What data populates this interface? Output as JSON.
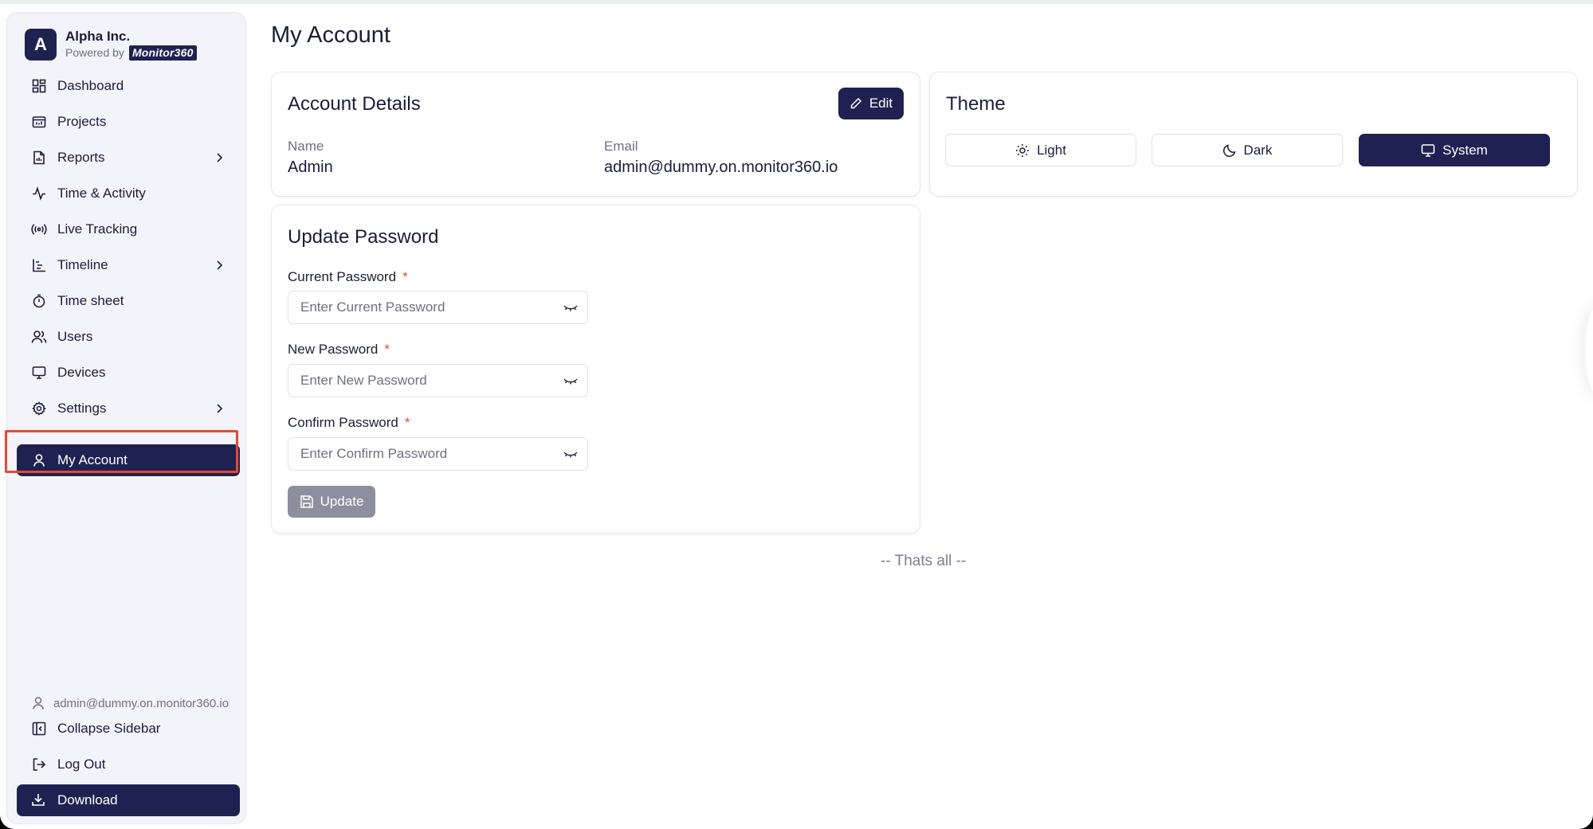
{
  "brand": {
    "initial": "A",
    "name": "Alpha Inc.",
    "powered_by": "Powered by",
    "logo_text": "Monitor360"
  },
  "sidebar": {
    "items": [
      {
        "label": "Dashboard",
        "icon": "dashboard-icon"
      },
      {
        "label": "Projects",
        "icon": "projects-icon"
      },
      {
        "label": "Reports",
        "icon": "reports-icon",
        "has_submenu": true
      },
      {
        "label": "Time & Activity",
        "icon": "activity-icon"
      },
      {
        "label": "Live Tracking",
        "icon": "live-tracking-icon"
      },
      {
        "label": "Timeline",
        "icon": "timeline-icon",
        "has_submenu": true
      },
      {
        "label": "Time sheet",
        "icon": "timer-icon"
      },
      {
        "label": "Users",
        "icon": "users-icon"
      },
      {
        "label": "Devices",
        "icon": "monitor-icon"
      },
      {
        "label": "Settings",
        "icon": "gear-icon",
        "has_submenu": true
      },
      {
        "label": "My Account",
        "icon": "user-icon",
        "active": true
      }
    ],
    "user_email": "admin@dummy.on.monitor360.io",
    "collapse_label": "Collapse Sidebar",
    "logout_label": "Log Out",
    "download_label": "Download"
  },
  "page": {
    "title": "My Account"
  },
  "account_details": {
    "title": "Account Details",
    "edit_label": "Edit",
    "name_label": "Name",
    "name_value": "Admin",
    "email_label": "Email",
    "email_value": "admin@dummy.on.monitor360.io"
  },
  "theme": {
    "title": "Theme",
    "options": [
      {
        "label": "Light",
        "icon": "sun-icon"
      },
      {
        "label": "Dark",
        "icon": "moon-icon"
      },
      {
        "label": "System",
        "icon": "monitor-icon",
        "selected": true
      }
    ]
  },
  "update_password": {
    "title": "Update Password",
    "current_label": "Current Password",
    "current_placeholder": "Enter Current Password",
    "new_label": "New Password",
    "new_placeholder": "Enter New Password",
    "confirm_label": "Confirm Password",
    "confirm_placeholder": "Enter Confirm Password",
    "required_mark": "*",
    "update_label": "Update"
  },
  "footer": {
    "note": "-- Thats all --"
  },
  "colors": {
    "primary": "#1f2250",
    "highlight": "#e8482f",
    "disabled_button": "#8d8f9e"
  }
}
